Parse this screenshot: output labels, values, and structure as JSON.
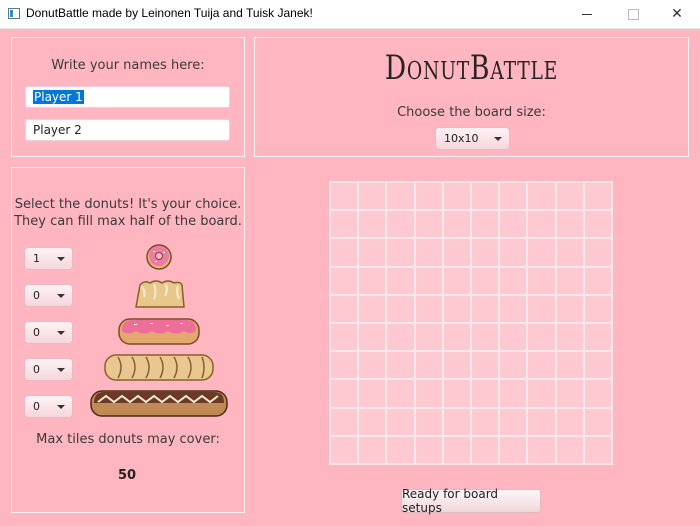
{
  "window": {
    "title": "DonutBattle made by Leinonen Tuija and Tuisk Janek!"
  },
  "names": {
    "label": "Write your names here:",
    "player1": "Player 1",
    "player2": "Player 2"
  },
  "header": {
    "game_title": "DonutBattle",
    "board_label": "Choose the board size:",
    "board_size": "10x10"
  },
  "donuts": {
    "label_line1": "Select the donuts! It's your choice.",
    "label_line2": "They can fill max half of the board.",
    "counts": [
      "1",
      "0",
      "0",
      "0",
      "0"
    ],
    "max_label": "Max tiles donuts may cover:",
    "max_value": "50"
  },
  "board": {
    "rows": 10,
    "cols": 10
  },
  "actions": {
    "ready_label": "Ready for board setups"
  },
  "colors": {
    "background": "#ffb6c1",
    "grid_cell": "#ffc9d1",
    "grid_line": "#f5e7ea",
    "selection": "#0078d7"
  }
}
